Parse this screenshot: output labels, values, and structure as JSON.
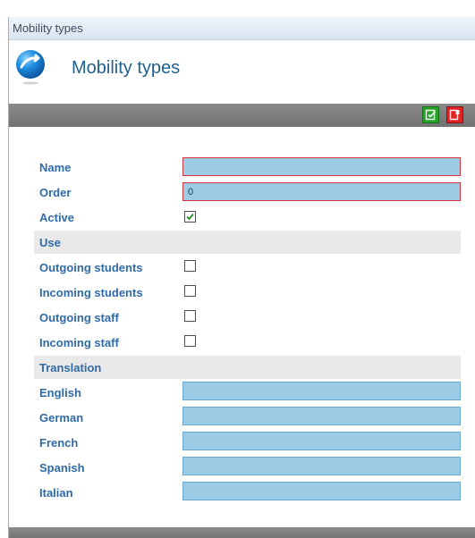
{
  "window": {
    "title": "Mobility types"
  },
  "header": {
    "title": "Mobility types",
    "logo_icon": "blue-sphere-arrow-icon"
  },
  "toolbar": {
    "save_icon": "save-icon",
    "cancel_icon": "cancel-icon",
    "save_color": "#27a427",
    "cancel_color": "#e02424"
  },
  "form": {
    "name": {
      "label": "Name",
      "value": ""
    },
    "order": {
      "label": "Order",
      "value": "0"
    },
    "active": {
      "label": "Active",
      "checked": true
    },
    "use": {
      "title": "Use",
      "items": [
        {
          "label": "Outgoing students",
          "checked": false
        },
        {
          "label": "Incoming students",
          "checked": false
        },
        {
          "label": "Outgoing staff",
          "checked": false
        },
        {
          "label": "Incoming staff",
          "checked": false
        }
      ]
    },
    "translation": {
      "title": "Translation",
      "items": [
        {
          "label": "English",
          "value": ""
        },
        {
          "label": "German",
          "value": ""
        },
        {
          "label": "French",
          "value": ""
        },
        {
          "label": "Spanish",
          "value": ""
        },
        {
          "label": "Italian",
          "value": ""
        }
      ]
    }
  },
  "colors": {
    "label_blue": "#2f6aa8",
    "field_fill": "#9ccbe6",
    "required_border": "#d6343f"
  }
}
